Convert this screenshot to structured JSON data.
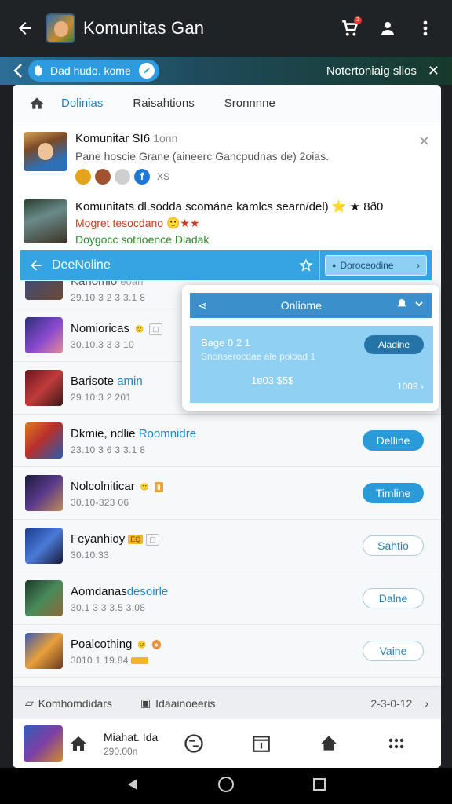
{
  "appbar": {
    "title": "Komunitas Gan",
    "cart_count": "2"
  },
  "banner": {
    "pill_label": "Dad hudo. kome",
    "note": "Notertoniaig slios"
  },
  "tabs": [
    "Dolinias",
    "Raisahtions",
    "Sronnnne"
  ],
  "post1": {
    "name": "Komunitar SI6",
    "name_sub": "1onn",
    "desc": "Pane hoscie Grane (aineerc Gancpudnas de) 2oias.",
    "react_count": "XS"
  },
  "post2": {
    "line1": "Komunitats dl.sodda scománe kamlcs searn/del) ⭐ ★ 8ð0",
    "line2": "Mogret tesocdano 🙂★★",
    "line3": "Doygocc sotrioence Dladak"
  },
  "bluebar": {
    "label": "DeeNoline",
    "cta": "Doroceodine"
  },
  "rows": [
    {
      "title": "Kanomio",
      "title_extra": "eoan",
      "meta": "29.10 3 2 3 3.1 8",
      "button": "",
      "style": ""
    },
    {
      "title": "Nomioricas",
      "badge": "🙂",
      "meta": "30.10.3 3 3 10",
      "button": "",
      "style": ""
    },
    {
      "title": "Barisote",
      "highlight": "amin",
      "meta": "29.10:3 2 201",
      "button": "",
      "style": ""
    },
    {
      "title": "Dkmie, ndlie",
      "highlight": "Roomnidre",
      "meta": "23.10 3 6 3 3.1 8",
      "button": "Delline",
      "style": "filled"
    },
    {
      "title": "Nolcolniticar",
      "badge": "🙂",
      "meta": "30.10-323 06",
      "button": "Timline",
      "style": "filled"
    },
    {
      "title": "Feyanhioy",
      "badge": "EQ",
      "meta": "30.10.33",
      "button": "Sahtio",
      "style": "outline"
    },
    {
      "title": "Aomdanas",
      "highlight": "desoirle",
      "meta": "30.1 3 3 3.5 3.08",
      "button": "Dalne",
      "style": "outline"
    },
    {
      "title": "Poalcothing",
      "badge": "🙂",
      "meta": "3010 1 19.84",
      "button": "Vaine",
      "style": "outline"
    }
  ],
  "popup": {
    "title": "Onliome",
    "line1": "Bage 0 2 1",
    "line2": "Snonserocdae ale poibad 1",
    "amount": "1ɐ03 $5$",
    "pill": "Aladine",
    "more": "1009"
  },
  "footbar": {
    "left": "Komhomdidars",
    "middle": "Idaainoeeris",
    "date": "2-3-0-12"
  },
  "dock": {
    "user_name": "Miahat. Ida",
    "user_sub": "290.00n"
  }
}
